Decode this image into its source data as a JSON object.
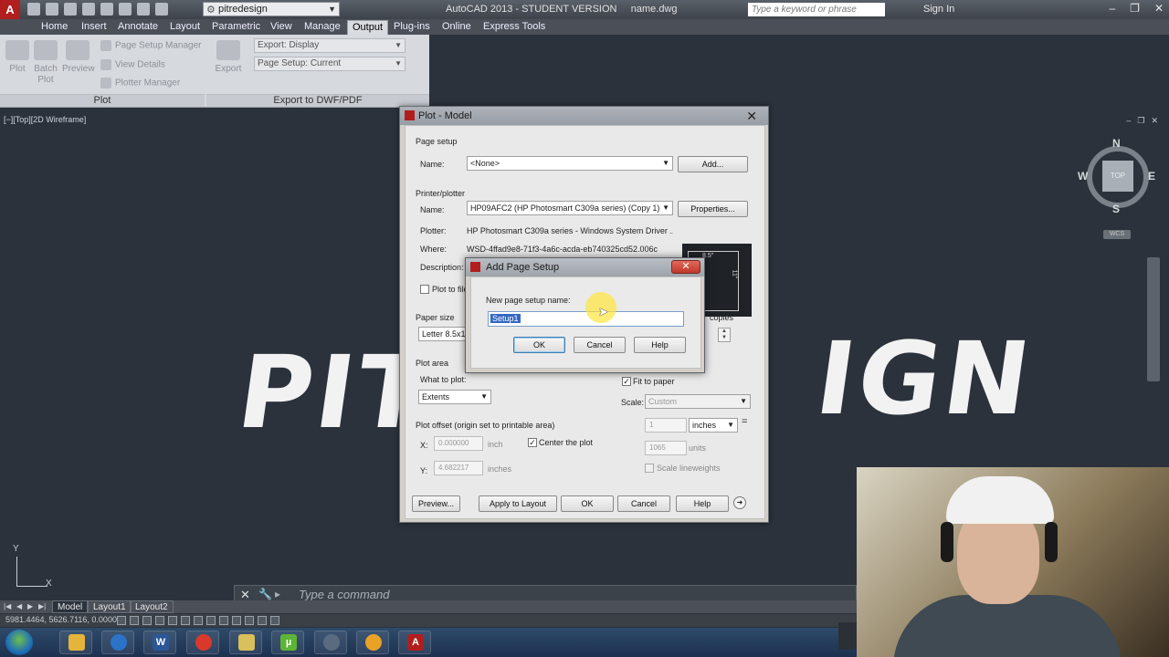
{
  "titlebar": {
    "app_logo": "A",
    "workspace": "pitredesign",
    "app_title": "AutoCAD 2013 - STUDENT VERSION     name.dwg",
    "search_placeholder": "Type a keyword or phrase",
    "sign_in": "Sign In"
  },
  "menu": {
    "tabs": [
      "Home",
      "Insert",
      "Annotate",
      "Layout",
      "Parametric",
      "View",
      "Manage",
      "Output",
      "Plug-ins",
      "Online",
      "Express Tools"
    ],
    "active": "Output"
  },
  "ribbon": {
    "plot_panel": {
      "title": "Plot",
      "plot": "Plot",
      "batch_plot": "Batch Plot",
      "preview": "Preview",
      "page_setup_manager": "Page Setup Manager",
      "view_details": "View Details",
      "plotter_manager": "Plotter Manager"
    },
    "export_panel": {
      "title": "Export to DWF/PDF",
      "export": "Export",
      "export_display": "Export: Display",
      "page_setup_current": "Page Setup: Current"
    }
  },
  "viewport": {
    "label": "[−][Top][2D Wireframe]",
    "logo_left": "PIT",
    "logo_right": "IGN",
    "viewcube": {
      "n": "N",
      "s": "S",
      "e": "E",
      "w": "W",
      "top": "TOP",
      "wcs": "WCS"
    },
    "ucs_x": "X",
    "ucs_y": "Y"
  },
  "command": {
    "placeholder": "Type a command"
  },
  "layout_tabs": {
    "model": "Model",
    "layout1": "Layout1",
    "layout2": "Layout2"
  },
  "status": {
    "coords": "5981.4464, 5626.7116, 0.0000"
  },
  "plot_dialog": {
    "title": "Plot - Model",
    "page_setup_heading": "Page setup",
    "name_label": "Name:",
    "page_setup_name": "<None>",
    "add_button": "Add...",
    "printer_heading": "Printer/plotter",
    "printer_name": "HP09AFC2 (HP Photosmart C309a series) (Copy 1)",
    "properties_button": "Properties...",
    "plotter_label": "Plotter:",
    "plotter_value": "HP Photosmart C309a series - Windows System Driver ...",
    "where_label": "Where:",
    "where_value": "WSD-4ffad9e8-71f3-4a6c-acda-eb740325cd52.006c",
    "description_label": "Description:",
    "plot_to_file": "Plot to file",
    "paper_width": "8.5\"",
    "paper_height": "11\"",
    "paper_size_heading": "Paper size",
    "paper_size_value": "Letter 8.5x11",
    "copies_label": "copies",
    "plot_area_heading": "Plot area",
    "what_to_plot_label": "What to plot:",
    "what_to_plot_value": "Extents",
    "fit_to_paper": "Fit to paper",
    "scale_label": "Scale:",
    "scale_value": "Custom",
    "scale_num": "1",
    "scale_units": "inches",
    "scale_den": "1065",
    "scale_den_units": "units",
    "scale_lineweights": "Scale lineweights",
    "offset_heading": "Plot offset (origin set to printable area)",
    "x_label": "X:",
    "x_value": "0.000000",
    "y_label": "Y:",
    "y_value": "4.682217",
    "offset_units": "inch",
    "offset_units_y": "inches",
    "center_the_plot": "Center the plot",
    "preview_button": "Preview...",
    "apply_button": "Apply to Layout",
    "ok_button": "OK",
    "cancel_button": "Cancel",
    "help_button": "Help"
  },
  "add_page_setup": {
    "title": "Add Page Setup",
    "prompt": "New page setup name:",
    "name_value": "Setup1",
    "ok_button": "OK",
    "cancel_button": "Cancel",
    "help_button": "Help"
  }
}
